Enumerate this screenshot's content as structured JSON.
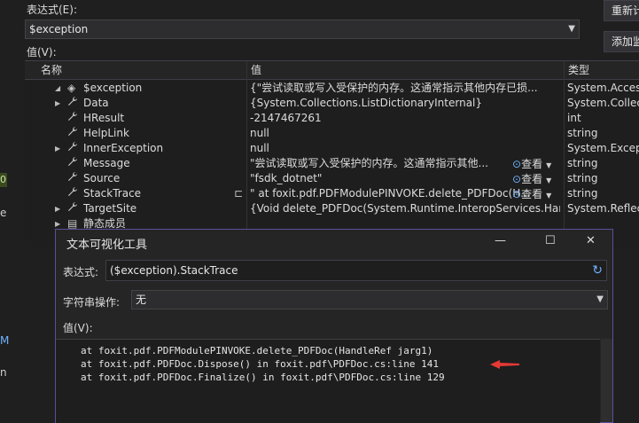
{
  "expression": {
    "label": "表达式(E):",
    "value": "$exception",
    "recalc_button": "重新计",
    "add_watch_button": "添加监"
  },
  "value_label": "值(V):",
  "columns": {
    "name": "名称",
    "value": "值",
    "type": "类型"
  },
  "rows": [
    {
      "name": "$exception",
      "value": "{\"尝试读取或写入受保护的内存。这通常指示其他内存已损...",
      "type": "System.AccessV",
      "expander": "◢",
      "icon": "exception-object-icon"
    },
    {
      "name": "Data",
      "value": "{System.Collections.ListDictionaryInternal}",
      "type": "System.Collecti",
      "expander": "▶",
      "icon": "wrench-icon"
    },
    {
      "name": "HResult",
      "value": "-2147467261",
      "type": "int",
      "expander": "",
      "icon": "wrench-icon"
    },
    {
      "name": "HelpLink",
      "value": "null",
      "type": "string",
      "expander": "",
      "icon": "wrench-icon"
    },
    {
      "name": "InnerException",
      "value": "null",
      "type": "System.Exceptio",
      "expander": "▶",
      "icon": "wrench-icon"
    },
    {
      "name": "Message",
      "value": "\"尝试读取或写入受保护的内存。这通常指示其他...",
      "type": "string",
      "expander": "",
      "icon": "wrench-icon",
      "view": "查看"
    },
    {
      "name": "Source",
      "value": "\"fsdk_dotnet\"",
      "type": "string",
      "expander": "",
      "icon": "wrench-icon",
      "view": "查看"
    },
    {
      "name": "StackTrace",
      "value": "\"   at foxit.pdf.PDFModulePINVOKE.delete_PDFDoc(H...",
      "type": "string",
      "expander": "",
      "icon": "wrench-icon",
      "view": "查看",
      "pin": "⊏"
    },
    {
      "name": "TargetSite",
      "value": "{Void delete_PDFDoc(System.Runtime.InteropServices.HandleRef)}",
      "type": "System.Reflecti",
      "expander": "▶",
      "icon": "wrench-icon"
    },
    {
      "name": "静态成员",
      "value": "",
      "type": "",
      "expander": "▶",
      "icon": "static-members-icon"
    }
  ],
  "dialog": {
    "title": "文本可视化工具",
    "expr_label": "表达式:",
    "expr_value": "($exception).StackTrace",
    "op_label": "字符串操作:",
    "op_value": "无",
    "value_label": "值(V):",
    "lines": [
      "at foxit.pdf.PDFModulePINVOKE.delete_PDFDoc(HandleRef jarg1)",
      "at foxit.pdf.PDFDoc.Dispose() in foxit.pdf\\PDFDoc.cs:line 141",
      "at foxit.pdf.PDFDoc.Finalize() in foxit.pdf\\PDFDoc.cs:line 129"
    ]
  },
  "left_edge": {
    "top_char": "0",
    "mid_char": "e",
    "lower_char": "M",
    "low_char": "n"
  },
  "colors": {
    "accent": "#6fb3ff",
    "arrow": "#e53935",
    "dialog_border": "#5a4f9a"
  }
}
